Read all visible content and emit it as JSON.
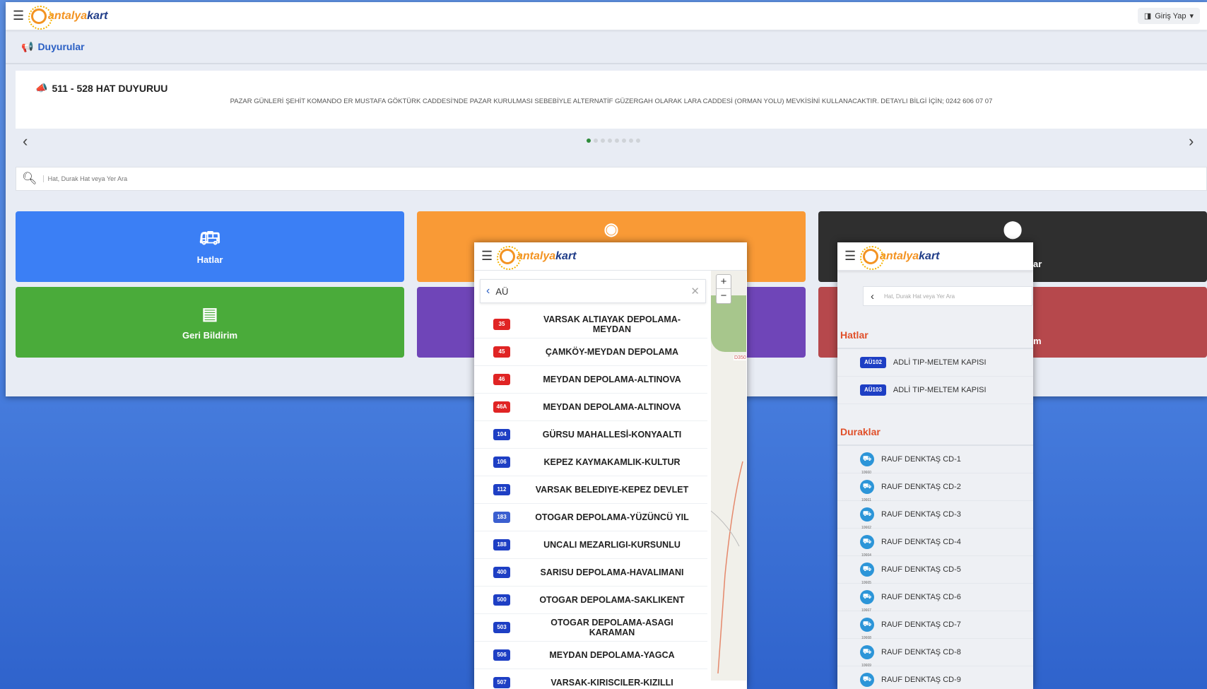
{
  "header": {
    "brand_a": "antalya",
    "brand_b": "kart",
    "login_label": "Giriş Yap"
  },
  "announcements": {
    "title": "Duyurular",
    "item_title": "511 - 528 HAT DUYURUU",
    "item_body": "PAZAR GÜNLERİ ŞEHİT KOMANDO ER MUSTAFA GÖKTÜRK CADDESİ'NDE PAZAR KURULMASI SEBEBİYLE ALTERNATİF GÜZERGAH OLARAK LARA CADDESİ (ORMAN YOLU) MEVKİSİNİ KULLANACAKTIR. DETAYLI BİLGİ İÇİN; 0242 606 07 07",
    "dots": 8,
    "active_dot": 0
  },
  "search": {
    "placeholder": "Hat, Durak Hat veya Yer Ara"
  },
  "tiles": [
    {
      "label": "Hatlar",
      "color": "#3b7ff5"
    },
    {
      "label": "Geri Bildirim",
      "color": "#4aab3a"
    }
  ],
  "panel1": {
    "query": "AÜ",
    "routes": [
      {
        "code": "35",
        "name": "VARSAK ALTIAYAK DEPOLAMA-MEYDAN",
        "color": "#e02424"
      },
      {
        "code": "45",
        "name": "ÇAMKÖY-MEYDAN DEPOLAMA",
        "color": "#e02424"
      },
      {
        "code": "46",
        "name": "MEYDAN DEPOLAMA-ALTINOVA",
        "color": "#e02424"
      },
      {
        "code": "46A",
        "name": "MEYDAN DEPOLAMA-ALTINOVA",
        "color": "#e02424"
      },
      {
        "code": "104",
        "name": "GÜRSU MAHALLESİ-KONYAALTI",
        "color": "#1e3fc4"
      },
      {
        "code": "106",
        "name": "KEPEZ KAYMAKAMLIK-KULTUR",
        "color": "#1e3fc4"
      },
      {
        "code": "112",
        "name": "VARSAK BELEDIYE-KEPEZ DEVLET",
        "color": "#1e3fc4"
      },
      {
        "code": "183",
        "name": "OTOGAR DEPOLAMA-YÜZÜNCÜ YIL",
        "color": "#3b5fd0"
      },
      {
        "code": "188",
        "name": "UNCALI MEZARLIGI-KURSUNLU",
        "color": "#1e3fc4"
      },
      {
        "code": "400",
        "name": "SARISU DEPOLAMA-HAVALIMANI",
        "color": "#1e3fc4"
      },
      {
        "code": "500",
        "name": "OTOGAR DEPOLAMA-SAKLIKENT",
        "color": "#1e3fc4"
      },
      {
        "code": "503",
        "name": "OTOGAR DEPOLAMA-ASAGI KARAMAN",
        "color": "#1e3fc4"
      },
      {
        "code": "506",
        "name": "MEYDAN DEPOLAMA-YAGCA",
        "color": "#1e3fc4"
      },
      {
        "code": "507",
        "name": "VARSAK-KIRISCILER-KIZILLI",
        "color": "#1e3fc4"
      }
    ],
    "map_label": "D350"
  },
  "panel2": {
    "search_placeholder": "Hat, Durak Hat veya Yer Ara",
    "lines_title": "Hatlar",
    "lines": [
      {
        "code": "AÜ102",
        "name": "ADLİ TIP-MELTEM KAPISI"
      },
      {
        "code": "AÜ103",
        "name": "ADLİ TIP-MELTEM KAPISI"
      }
    ],
    "stops_title": "Duraklar",
    "stops": [
      {
        "name": "RAUF DENKTAŞ CD-1",
        "num": "10660"
      },
      {
        "name": "RAUF DENKTAŞ CD-2",
        "num": "10661"
      },
      {
        "name": "RAUF DENKTAŞ CD-3",
        "num": "10662"
      },
      {
        "name": "RAUF DENKTAŞ CD-4",
        "num": "10664"
      },
      {
        "name": "RAUF DENKTAŞ CD-5",
        "num": "10665"
      },
      {
        "name": "RAUF DENKTAŞ CD-6",
        "num": "10667"
      },
      {
        "name": "RAUF DENKTAŞ CD-7",
        "num": "10668"
      },
      {
        "name": "RAUF DENKTAŞ CD-8",
        "num": "10669"
      },
      {
        "name": "RAUF DENKTAŞ CD-9",
        "num": ""
      }
    ],
    "right_fragment_1": "ar",
    "right_fragment_2": "m"
  }
}
